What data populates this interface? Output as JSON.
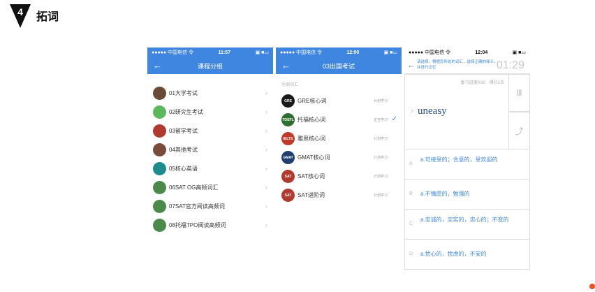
{
  "section": {
    "number": "4",
    "title": "拓词"
  },
  "phone1": {
    "status": {
      "carrier": "●●●●● 中国电信 令",
      "time": "11:57",
      "right": "▣ ■▭"
    },
    "title": "课程分组",
    "items": [
      {
        "label": "01大学考试",
        "color": "#6a4b3a"
      },
      {
        "label": "02研究生考试",
        "color": "#5cb85c"
      },
      {
        "label": "03留学考试",
        "color": "#b03a2e"
      },
      {
        "label": "04其他考试",
        "color": "#7a4a3a"
      },
      {
        "label": "05核心英语",
        "color": "#1e8c8c"
      },
      {
        "label": "06SAT OG高频词汇",
        "color": "#4c8a4c"
      },
      {
        "label": "07SAT官方阅读高频词",
        "color": "#4c8a4c"
      },
      {
        "label": "08托福TPO阅读高频词",
        "color": "#4c8a4c"
      }
    ]
  },
  "phone2": {
    "status": {
      "carrier": "●●●●● 中国电信 令",
      "time": "12:00",
      "right": "▣ ■▭"
    },
    "title": "03出国考试",
    "group_label": "全部词汇",
    "items": [
      {
        "icon": "GRE",
        "label": "GRE核心词",
        "tag": "计划学习",
        "color": "#1a1a1a",
        "checked": false
      },
      {
        "icon": "TOEFL",
        "label": "托福核心词",
        "tag": "正在学习",
        "color": "#2e6e2e",
        "checked": true
      },
      {
        "icon": "IELTS",
        "label": "雅思核心词",
        "tag": "计划学习",
        "color": "#c0392b",
        "checked": false
      },
      {
        "icon": "GMAT",
        "label": "GMAT核心词",
        "tag": "计划学习",
        "color": "#1d3e6e",
        "checked": false
      },
      {
        "icon": "SAT",
        "label": "SAT核心词",
        "tag": "计划学习",
        "color": "#b03a2e",
        "checked": false
      },
      {
        "icon": "SAT",
        "label": "SAT进阶词",
        "tag": "计划学习",
        "color": "#b03a2e",
        "checked": false
      }
    ]
  },
  "phone3": {
    "status": {
      "carrier": "●●●●● 中国电信 令",
      "time": "12:04",
      "right": "▣ ■▭"
    },
    "desc": "请选择，根据您所给的词汇，选择正确的释义，并进行记忆",
    "timer": "01:29",
    "progress": "复习进度0/10 · 得分1次",
    "word_number": "7",
    "word": "uneasy",
    "side_top": "Ⅲ",
    "side_bottom": "⤴",
    "options": [
      {
        "letter": "A",
        "text": "a.可接受的；合意的，受欢迎的"
      },
      {
        "letter": "B",
        "text": "a.不情愿的，勉强的"
      },
      {
        "letter": "C",
        "text": "a.忠诚的，忠实的，忠心的；不变的"
      },
      {
        "letter": "D",
        "text": "a.忧心的，忧虑的，不安的"
      }
    ]
  }
}
